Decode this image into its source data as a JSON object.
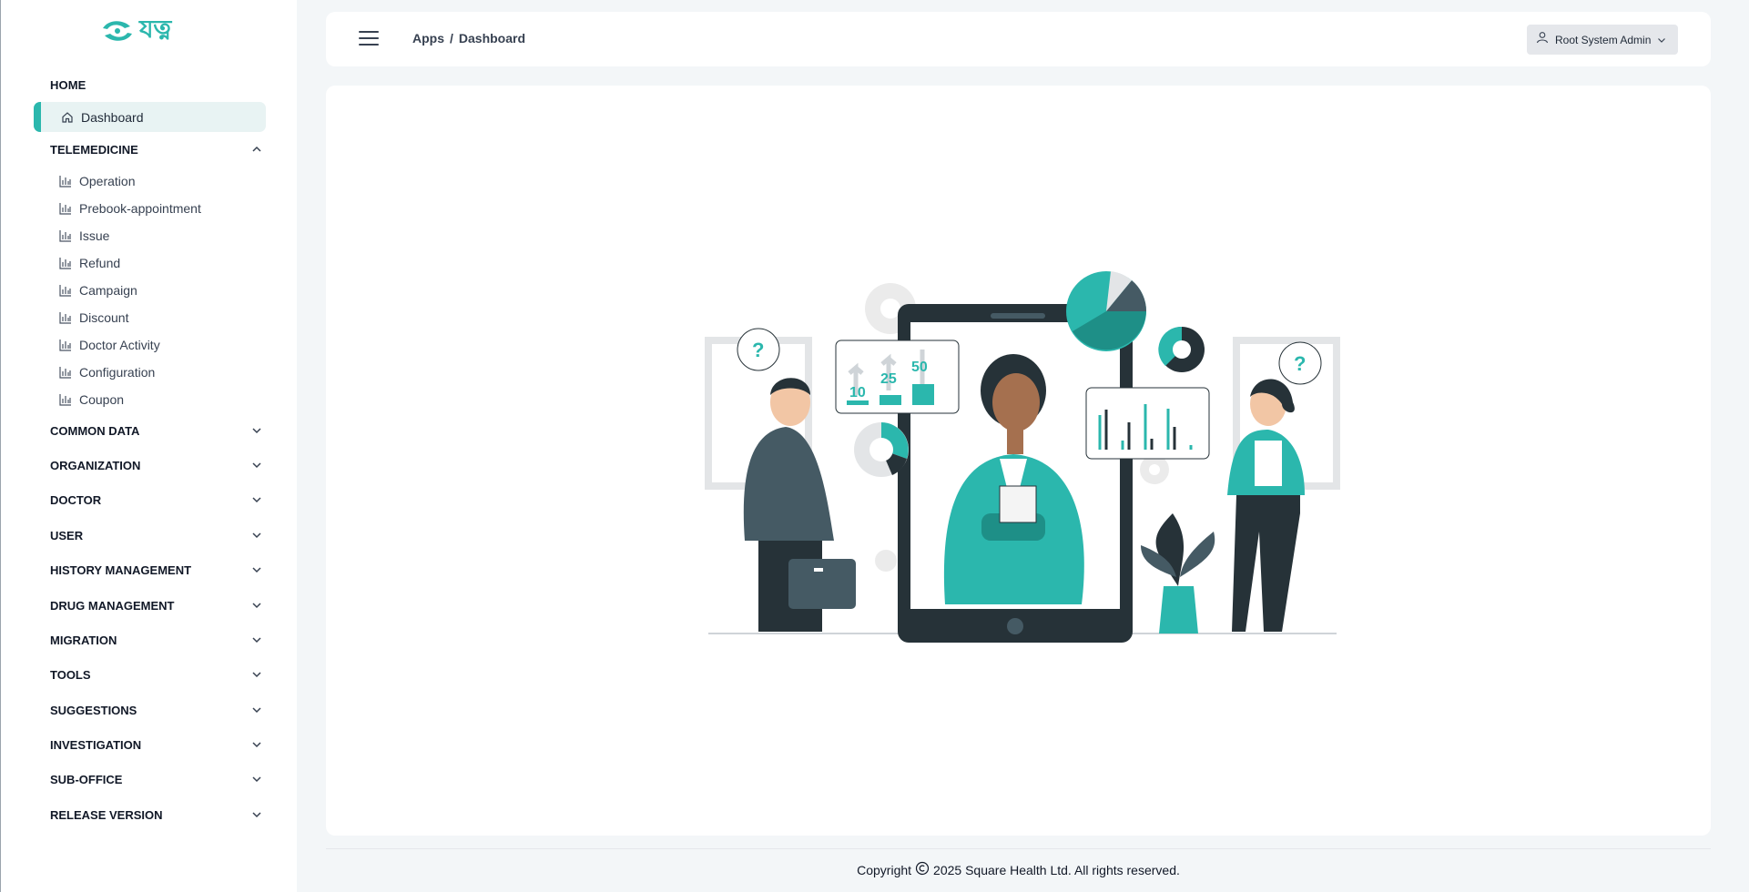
{
  "sidebar": {
    "logo_text": "যত্ন",
    "home_heading": "HOME",
    "dashboard_label": "Dashboard",
    "telemedicine_heading": "TELEMEDICINE",
    "telemedicine_items": [
      {
        "label": "Operation"
      },
      {
        "label": "Prebook-appointment"
      },
      {
        "label": "Issue"
      },
      {
        "label": "Refund"
      },
      {
        "label": "Campaign"
      },
      {
        "label": "Discount"
      },
      {
        "label": "Doctor Activity"
      },
      {
        "label": "Configuration"
      },
      {
        "label": "Coupon"
      }
    ],
    "sections": [
      {
        "label": "COMMON DATA"
      },
      {
        "label": "ORGANIZATION"
      },
      {
        "label": "DOCTOR"
      },
      {
        "label": "USER"
      },
      {
        "label": "HISTORY MANAGEMENT"
      },
      {
        "label": "DRUG MANAGEMENT"
      },
      {
        "label": "MIGRATION"
      },
      {
        "label": "TOOLS"
      },
      {
        "label": "SUGGESTIONS"
      },
      {
        "label": "INVESTIGATION"
      },
      {
        "label": "SUB-OFFICE"
      },
      {
        "label": "RELEASE VERSION"
      }
    ]
  },
  "header": {
    "breadcrumb_root": "Apps",
    "breadcrumb_sep": "/",
    "breadcrumb_current": "Dashboard",
    "user_name": "Root System Admin"
  },
  "illustration": {
    "stat_labels": [
      "10",
      "25",
      "50"
    ]
  },
  "footer": {
    "copyright_prefix": "Copyright",
    "copyright_rest": "2025 Square Health Ltd. All rights reserved."
  },
  "colors": {
    "accent": "#2bb7ad",
    "dark": "#263238"
  }
}
